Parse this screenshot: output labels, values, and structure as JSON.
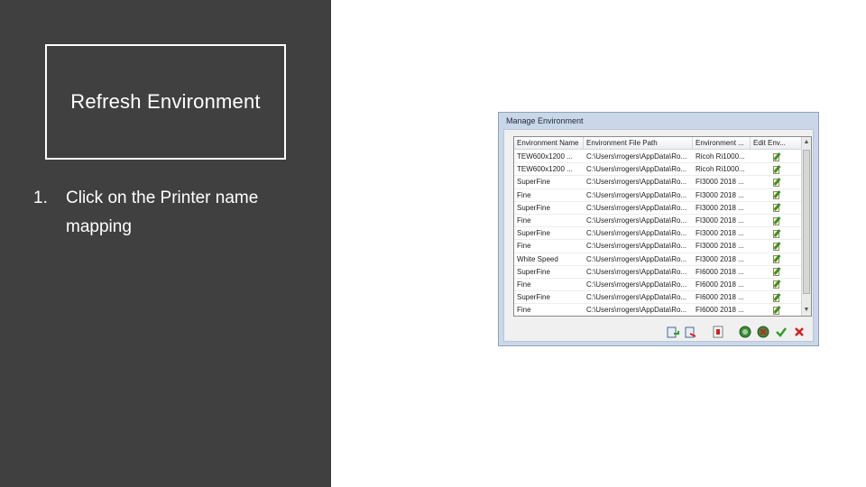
{
  "slide": {
    "title": "Refresh Environment",
    "steps": [
      {
        "num": "1.",
        "text": "Click on the Printer name mapping"
      }
    ]
  },
  "dialog": {
    "title": "Manage Environment",
    "columns": [
      "Environment Name",
      "Environment File Path",
      "Environment ...",
      "Edit Env..."
    ],
    "rows": [
      {
        "name": "TEW600x1200 ...",
        "path": "C:\\Users\\rrogers\\AppData\\Ro...",
        "env": "Ricoh Ri1000..."
      },
      {
        "name": "TEW600x1200 ...",
        "path": "C:\\Users\\rrogers\\AppData\\Ro...",
        "env": "Ricoh Ri1000..."
      },
      {
        "name": "SuperFine",
        "path": "C:\\Users\\rrogers\\AppData\\Ro...",
        "env": "FI3000 2018 ..."
      },
      {
        "name": "Fine",
        "path": "C:\\Users\\rrogers\\AppData\\Ro...",
        "env": "FI3000 2018 ..."
      },
      {
        "name": "SuperFine",
        "path": "C:\\Users\\rrogers\\AppData\\Ro...",
        "env": "FI3000 2018 ..."
      },
      {
        "name": "Fine",
        "path": "C:\\Users\\rrogers\\AppData\\Ro...",
        "env": "FI3000 2018 ..."
      },
      {
        "name": "SuperFine",
        "path": "C:\\Users\\rrogers\\AppData\\Ro...",
        "env": "FI3000 2018 ..."
      },
      {
        "name": "Fine",
        "path": "C:\\Users\\rrogers\\AppData\\Ro...",
        "env": "FI3000 2018 ..."
      },
      {
        "name": "White Speed",
        "path": "C:\\Users\\rrogers\\AppData\\Ro...",
        "env": "FI3000 2018 ..."
      },
      {
        "name": "SuperFine",
        "path": "C:\\Users\\rrogers\\AppData\\Ro...",
        "env": "FI6000 2018 ..."
      },
      {
        "name": "Fine",
        "path": "C:\\Users\\rrogers\\AppData\\Ro...",
        "env": "FI6000 2018 ..."
      },
      {
        "name": "SuperFine",
        "path": "C:\\Users\\rrogers\\AppData\\Ro...",
        "env": "FI6000 2018 ..."
      },
      {
        "name": "Fine",
        "path": "C:\\Users\\rrogers\\AppData\\Ro...",
        "env": "FI6000 2018 ..."
      }
    ],
    "toolbar_icons": [
      "import-icon",
      "export-icon",
      "printer-mapping-icon",
      "refresh-icon",
      "delete-icon",
      "ok-check-icon",
      "cancel-x-icon"
    ],
    "colors": {
      "ok": "#2e9e2e",
      "cancel": "#d42020",
      "titlebar": "#c9d7e8"
    }
  }
}
